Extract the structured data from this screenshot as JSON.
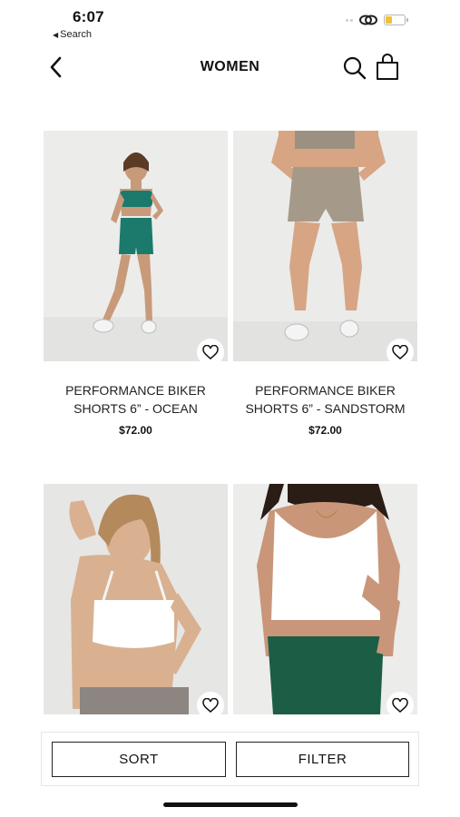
{
  "status_bar": {
    "time": "6:07",
    "back_app_label": "Search",
    "battery_level": 0.35,
    "battery_color": "#f1c232"
  },
  "nav": {
    "back_icon": "chevron-left-icon",
    "title": "WOMEN",
    "search_icon": "search-icon",
    "bag_icon": "shopping-bag-icon"
  },
  "products": [
    {
      "name": "PERFORMANCE BIKER SHORTS 6” - OCEAN",
      "price": "$72.00",
      "image": "model-teal-set-photo",
      "favorited": false
    },
    {
      "name": "PERFORMANCE BIKER SHORTS 6” - SANDSTORM",
      "price": "$72.00",
      "image": "model-sandstorm-shorts-photo",
      "favorited": false
    },
    {
      "name": "",
      "price": "",
      "image": "model-white-bra-photo",
      "favorited": false
    },
    {
      "name": "",
      "price": "",
      "image": "model-white-top-green-bottoms-photo",
      "favorited": false
    }
  ],
  "bottom_bar": {
    "sort_label": "SORT",
    "filter_label": "FILTER"
  },
  "colors": {
    "ocean": "#1c7a6c",
    "sandstorm": "#a59a8a",
    "forest": "#1b5e45",
    "text": "#111111"
  }
}
